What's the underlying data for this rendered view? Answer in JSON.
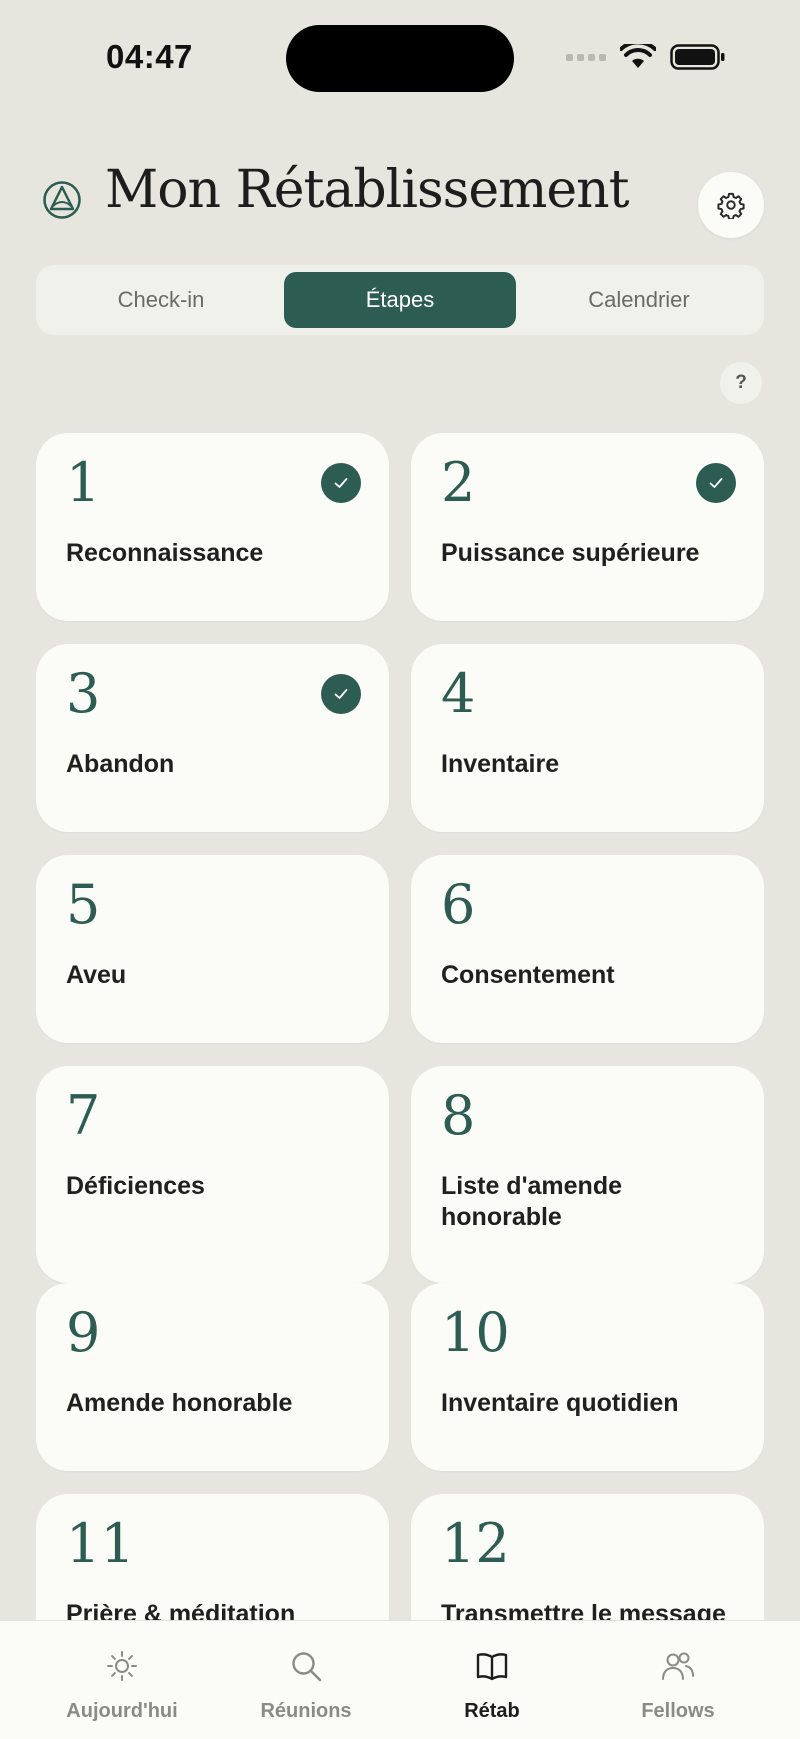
{
  "status_bar": {
    "time": "04:47"
  },
  "header": {
    "title": "Mon Rétablissement"
  },
  "segments": [
    {
      "label": "Check-in"
    },
    {
      "label": "Étapes",
      "active": true
    },
    {
      "label": "Calendrier"
    }
  ],
  "help": {
    "label": "?"
  },
  "steps": [
    {
      "number": "1",
      "label": "Reconnaissance",
      "done": true
    },
    {
      "number": "2",
      "label": "Puissance supérieure",
      "done": true
    },
    {
      "number": "3",
      "label": "Abandon",
      "done": true
    },
    {
      "number": "4",
      "label": "Inventaire",
      "done": false
    },
    {
      "number": "5",
      "label": "Aveu",
      "done": false
    },
    {
      "number": "6",
      "label": "Consentement",
      "done": false
    },
    {
      "number": "7",
      "label": "Déficiences",
      "done": false
    },
    {
      "number": "8",
      "label": "Liste d'amende honorable",
      "done": false
    },
    {
      "number": "9",
      "label": "Amende honorable",
      "done": false
    },
    {
      "number": "10",
      "label": "Inventaire quotidien",
      "done": false
    },
    {
      "number": "11",
      "label": "Prière & méditation",
      "done": false
    },
    {
      "number": "12",
      "label": "Transmettre le message",
      "done": false
    }
  ],
  "tabbar": [
    {
      "label": "Aujourd'hui",
      "icon": "sun-icon"
    },
    {
      "label": "Réunions",
      "icon": "search-icon"
    },
    {
      "label": "Rétab",
      "icon": "book-icon",
      "active": true
    },
    {
      "label": "Fellows",
      "icon": "people-icon"
    }
  ],
  "colors": {
    "accent": "#2d5c52",
    "background": "#e6e6df",
    "card": "#fbfbf7"
  }
}
